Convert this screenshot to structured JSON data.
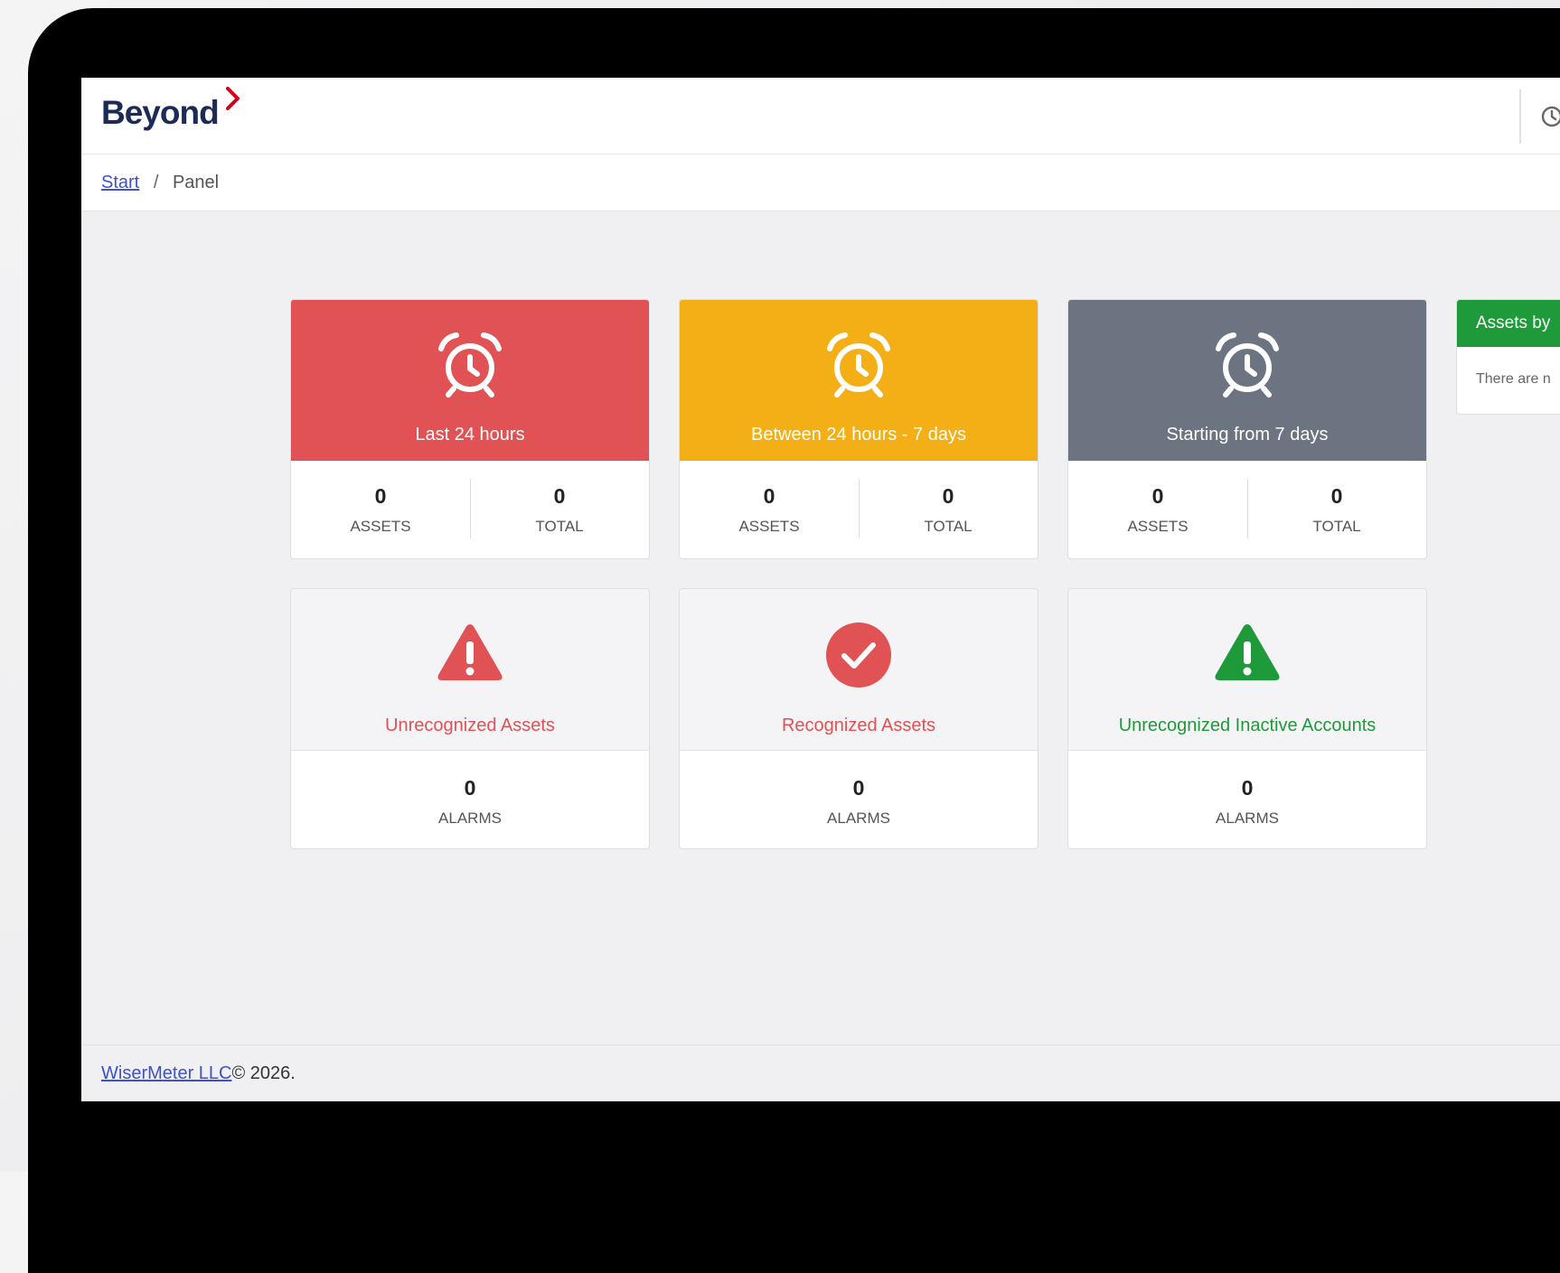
{
  "header": {
    "logo_text": "Beyond",
    "colors": {
      "logo": "#1c2a55",
      "logo_chevron": "#d0021b"
    }
  },
  "breadcrumb": {
    "start": "Start",
    "separator": "/",
    "current": "Panel"
  },
  "time_cards": [
    {
      "label": "Last 24 hours",
      "color": "#e05253",
      "assets_value": "0",
      "assets_label": "ASSETS",
      "total_value": "0",
      "total_label": "TOTAL",
      "icon": "alarm-clock-icon"
    },
    {
      "label": "Between 24 hours - 7 days",
      "color": "#f4af17",
      "assets_value": "0",
      "assets_label": "ASSETS",
      "total_value": "0",
      "total_label": "TOTAL",
      "icon": "alarm-clock-icon"
    },
    {
      "label": "Starting from 7 days",
      "color": "#6c7482",
      "assets_value": "0",
      "assets_label": "ASSETS",
      "total_value": "0",
      "total_label": "TOTAL",
      "icon": "alarm-clock-icon"
    }
  ],
  "status_cards": [
    {
      "label": "Unrecognized Assets",
      "color": "#e05253",
      "value": "0",
      "caption": "ALARMS",
      "icon": "warning-triangle-icon"
    },
    {
      "label": "Recognized Assets",
      "color": "#e05253",
      "value": "0",
      "caption": "ALARMS",
      "icon": "check-circle-icon"
    },
    {
      "label": "Unrecognized Inactive Accounts",
      "color": "#1f9a3a",
      "value": "0",
      "caption": "ALARMS",
      "icon": "warning-triangle-icon"
    }
  ],
  "side_panel": {
    "title": "Assets by",
    "body": "There are n",
    "color": "#1f9a3a"
  },
  "footer": {
    "company": "WiserMeter LLC",
    "copyright": "© 2026."
  }
}
